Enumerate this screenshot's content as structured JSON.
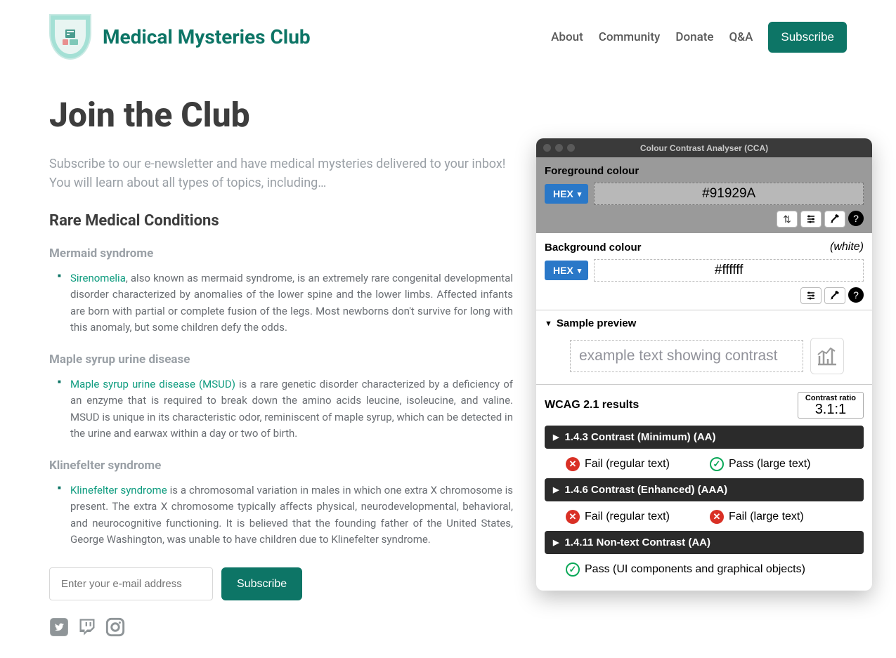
{
  "header": {
    "brand": "Medical Mysteries Club",
    "nav": [
      "About",
      "Community",
      "Donate",
      "Q&A"
    ],
    "subscribe": "Subscribe"
  },
  "main": {
    "title": "Join the Club",
    "intro": "Subscribe to our e-newsletter and have medical mysteries delivered to your inbox! You will learn about all types of topics, including…",
    "section_title": "Rare Medical Conditions",
    "conditions": [
      {
        "title": "Mermaid syndrome",
        "link": "Sirenomelia",
        "text": ", also known as mermaid syndrome, is an extremely rare congenital developmental disorder characterized by anomalies of the lower spine and the lower limbs. Affected infants are born with partial or complete fusion of the legs. Most newborns don't survive for long with this anomaly, but some children defy the odds."
      },
      {
        "title": "Maple syrup urine disease",
        "link": "Maple syrup urine disease (MSUD)",
        "text": " is a rare genetic disorder characterized by a deficiency of an enzyme that is required to break down the amino acids leucine, isoleucine, and valine. MSUD is unique in its characteristic odor, reminiscent of maple syrup, which can be detected in the urine and earwax within a day or two of birth."
      },
      {
        "title": "Klinefelter syndrome",
        "link": "Klinefelter syndrome",
        "text": " is a chromosomal variation in males in which one extra X chromosome is present. The extra X chromosome typically affects physical, neurodevelopmental, behavioral, and neurocognitive functioning. It is believed that the founding father of the United States, George Washington, was unable to have children due to Klinefelter syndrome."
      }
    ],
    "email_placeholder": "Enter your e-mail address",
    "subscribe_btn": "Subscribe"
  },
  "cca": {
    "title": "Colour Contrast Analyser (CCA)",
    "fg_label": "Foreground colour",
    "bg_label": "Background colour",
    "hex_label": "HEX",
    "fg_value": "#91929A",
    "bg_value": "#ffffff",
    "bg_note": "(white)",
    "sample_label": "Sample preview",
    "sample_text": "example text showing contrast",
    "results_title": "WCAG 2.1 results",
    "ratio_label": "Contrast ratio",
    "ratio_value": "3.1:1",
    "criteria": [
      {
        "label": "1.4.3 Contrast (Minimum) (AA)",
        "results": [
          {
            "status": "fail",
            "text": "Fail (regular text)"
          },
          {
            "status": "pass",
            "text": "Pass (large text)"
          }
        ]
      },
      {
        "label": "1.4.6 Contrast (Enhanced) (AAA)",
        "results": [
          {
            "status": "fail",
            "text": "Fail (regular text)"
          },
          {
            "status": "fail",
            "text": "Fail (large text)"
          }
        ]
      },
      {
        "label": "1.4.11 Non-text Contrast (AA)",
        "results": [
          {
            "status": "pass",
            "text": "Pass (UI components and graphical objects)"
          }
        ]
      }
    ]
  }
}
